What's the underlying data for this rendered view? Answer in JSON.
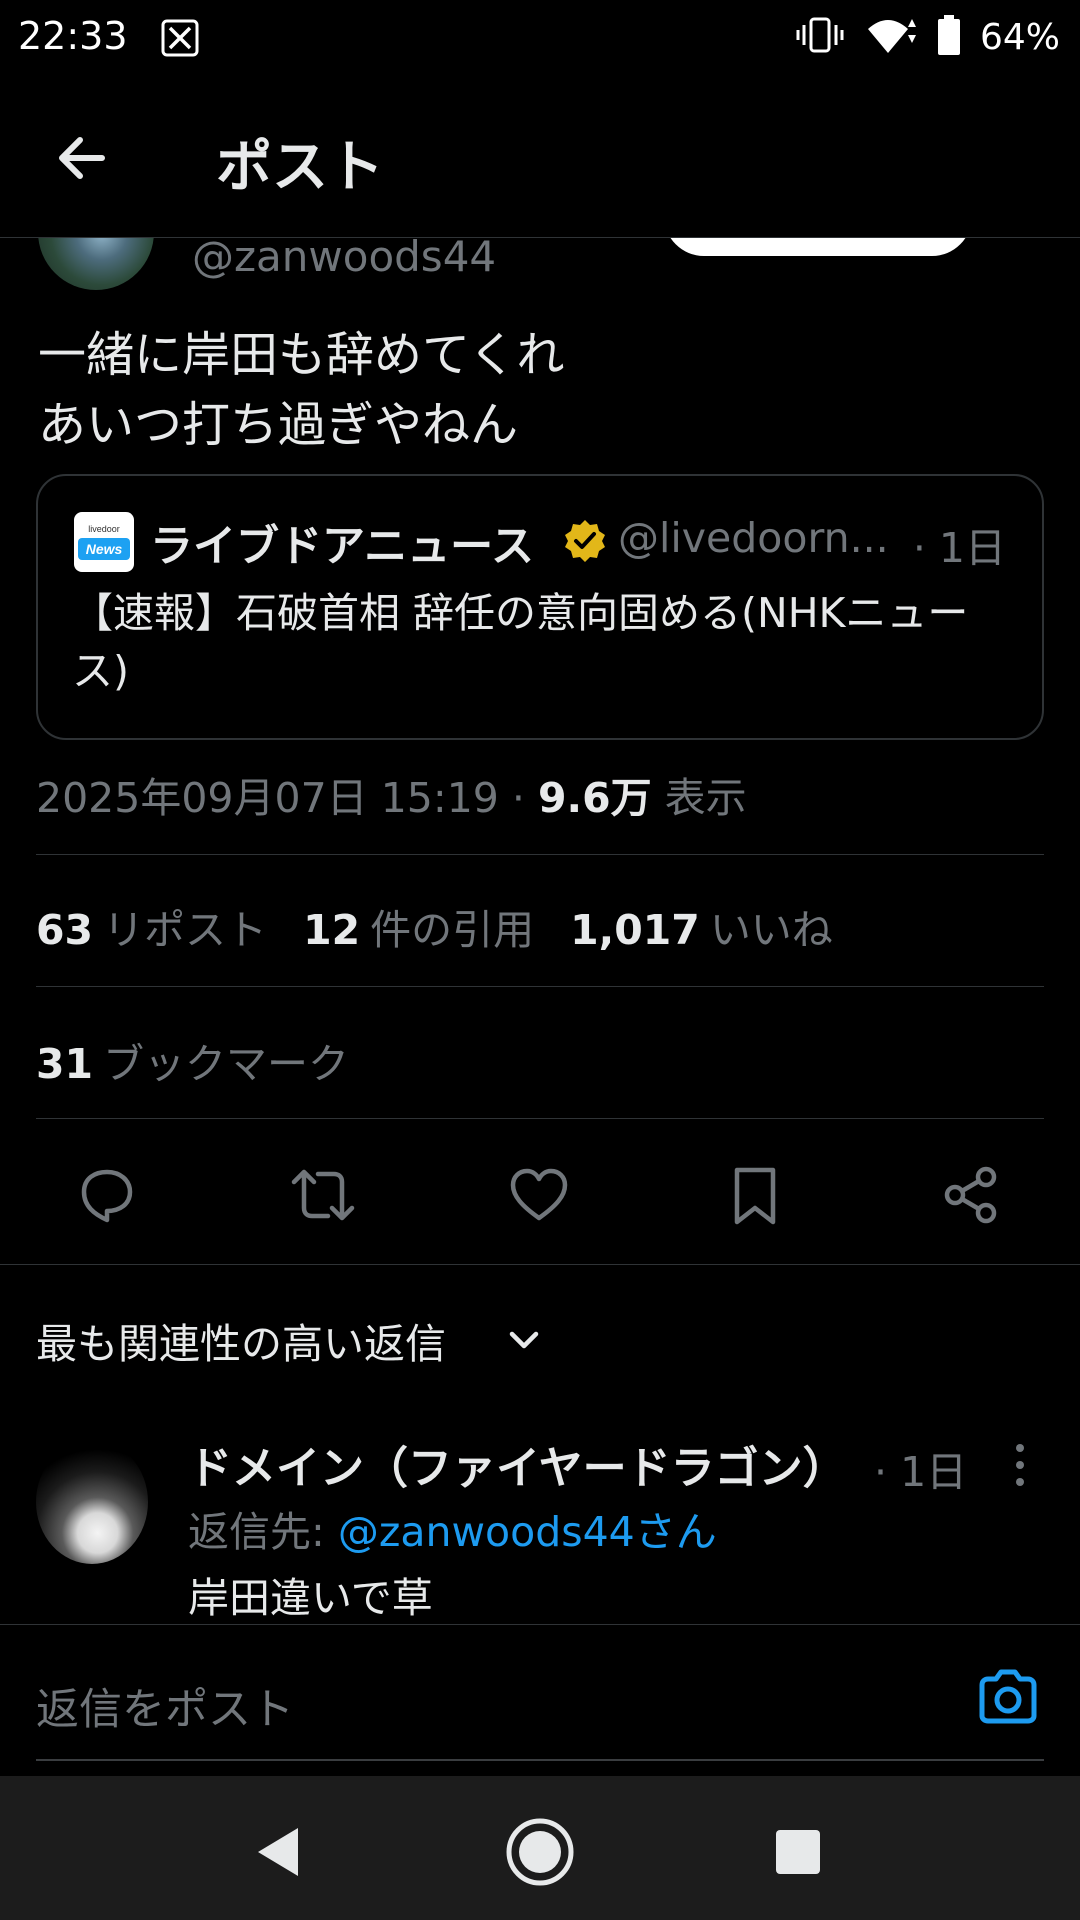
{
  "status_bar": {
    "time": "22:33",
    "battery": "64%",
    "icons": [
      "x-app-icon",
      "vibrate-icon",
      "wifi-icon",
      "battery-icon"
    ]
  },
  "header": {
    "title": "ポスト",
    "back_icon": "arrow-left-icon"
  },
  "post": {
    "author_handle": "@zanwoods44",
    "text": "一緒に岸田も辞めてくれ\nあいつ打ち過ぎやねん",
    "quote": {
      "logo_top": "livedoor",
      "logo_bottom": "News",
      "name": "ライブドアニュース",
      "handle": "@livedoorn...",
      "time": "· 1日",
      "body": "【速報】石破首相 辞任の意向固める(NHKニュース)"
    },
    "timestamp": "2025年09月07日 15:19 · ",
    "views_count": "9.6万",
    "views_label": " 表示",
    "stats": {
      "reposts_count": "63",
      "reposts_label": "リポスト",
      "quotes_count": "12",
      "quotes_label": "件の引用",
      "likes_count": "1,017",
      "likes_label": "いいね",
      "bookmarks_count": "31",
      "bookmarks_label": "ブックマーク"
    }
  },
  "replies": {
    "sort_label": "最も関連性の高い返信",
    "items": [
      {
        "name": "ドメイン（ファイヤードラゴン）",
        "time": "· 1日",
        "reply_to_label": "返信先: ",
        "reply_to_handle": "@zanwoods44さん",
        "text": "岸田違いで草"
      }
    ]
  },
  "composer": {
    "placeholder": "返信をポスト"
  },
  "colors": {
    "background": "#000000",
    "text_primary": "#e7e9ea",
    "text_secondary": "#71767b",
    "accent": "#1d9bf0",
    "verified_gold": "#e2b719",
    "divider": "#2f3336"
  }
}
